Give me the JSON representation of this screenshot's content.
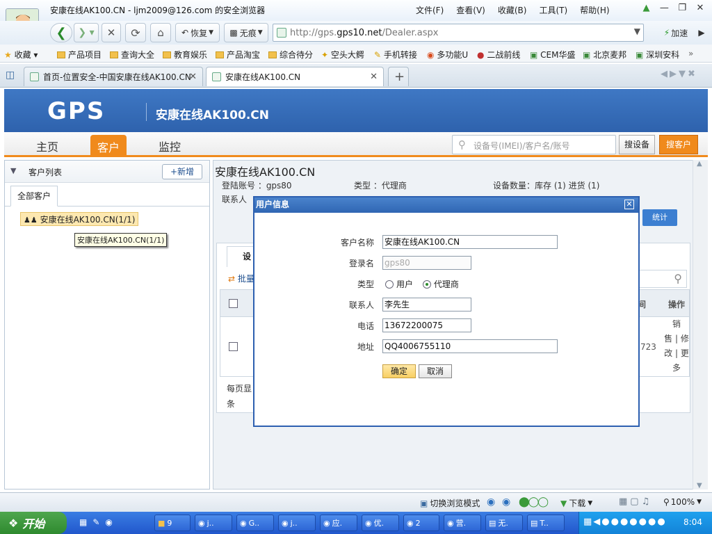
{
  "browser": {
    "window_title": "安康在线AK100.CN - ljm2009@126.com 的安全浏览器",
    "menu": [
      "文件(F)",
      "查看(V)",
      "收藏(B)",
      "工具(T)",
      "帮助(H)"
    ],
    "nav": {
      "restore_label": "恢复",
      "no_trace_label": "无痕",
      "speed_label": "加速"
    },
    "address": {
      "prefix": "http://gps.",
      "domain": "gps10.net",
      "path": "/Dealer.aspx"
    },
    "favorites": [
      "收藏",
      "产品项目",
      "查询大全",
      "教育娱乐",
      "产品淘宝",
      "综合待分",
      "空头大鳄",
      "手机转接",
      "多功能U",
      "二战前线",
      "CEM华盛",
      "北京麦邦",
      "深圳安科"
    ],
    "tabs": [
      {
        "label": "首页-位置安全-中国安康在线AK100.CN"
      },
      {
        "label": "安康在线AK100.CN"
      }
    ],
    "status": {
      "switch_mode": "切换浏览模式",
      "download": "下载",
      "zoom": "100%"
    }
  },
  "app": {
    "logo": "GPS",
    "site_title": "安康在线AK100.CN",
    "nav_tabs": [
      "主页",
      "客户",
      "监控"
    ],
    "search_placeholder": "设备号(IMEI)/客户名/账号",
    "search_device_button": "搜设备",
    "search_customer_button": "搜客户",
    "left": {
      "header": "客户列表",
      "add_button": "+新增",
      "tab_all": "全部客户",
      "tree_node": "安康在线AK100.CN(1/1)",
      "tooltip": "安康在线AK100.CN(1/1)"
    },
    "right": {
      "title": "安康在线AK100.CN",
      "login_account": "登陆账号 ：gps80",
      "type": "类型 ：代理商",
      "device_count": "设备数量：库存 (1) 进货 (1)",
      "contact": "联系人",
      "stats_button": "统计",
      "device_tab": "设",
      "batch": "批量",
      "col_action": "操作",
      "col_partial": "间",
      "row_actions": [
        "销",
        "售 | 修",
        "改 | 更",
        "多"
      ],
      "row_partial": "723",
      "pager": [
        "每页显",
        "条"
      ]
    }
  },
  "modal": {
    "title": "用户信息",
    "fields": {
      "customer_name_label": "客户名称",
      "customer_name": "安康在线AK100.CN",
      "login_label": "登录名",
      "login_placeholder": "gps80",
      "type_label": "类型",
      "type_user": "用户",
      "type_agent": "代理商",
      "contact_label": "联系人",
      "contact": "李先生",
      "phone_label": "电话",
      "phone": "13672200075",
      "address_label": "地址",
      "address": "QQ4006755110"
    },
    "ok_button": "确定",
    "cancel_button": "取消"
  },
  "taskbar": {
    "start": "开始",
    "items": [
      "9",
      "j..",
      "G..",
      "j..",
      "应.",
      "优.",
      "2",
      "营.",
      "无.",
      "T.."
    ],
    "clock": "8:04"
  }
}
